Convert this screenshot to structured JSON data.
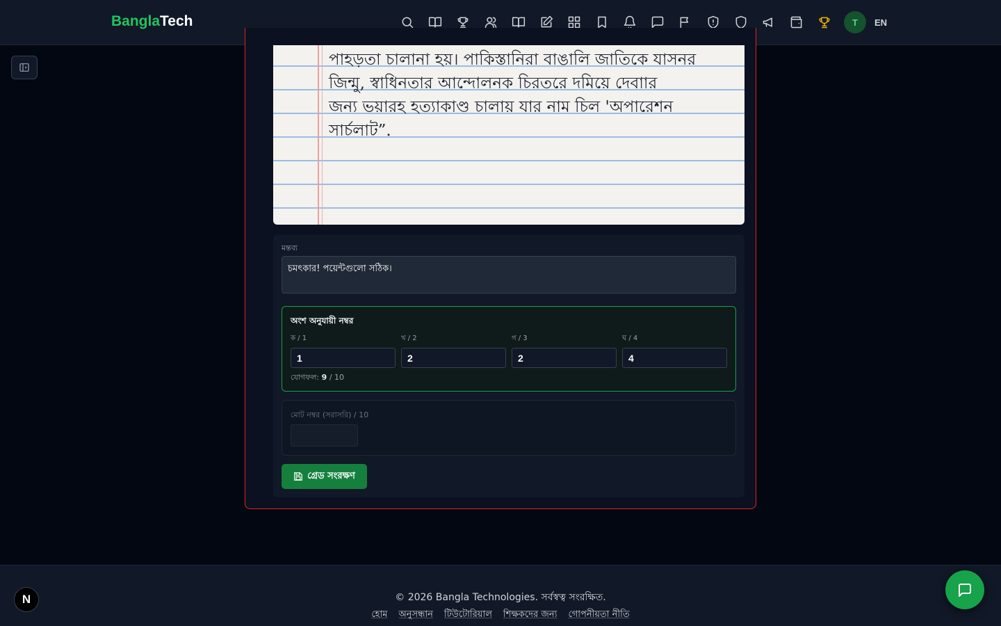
{
  "header": {
    "logo_part1": "Bangla",
    "logo_part2": "Tech",
    "nav_icons": [
      "search-icon",
      "book-icon",
      "trophy-icon",
      "users-icon",
      "book-open-icon",
      "edit-icon",
      "grid-icon",
      "bookmark-icon",
      "bell-icon",
      "message-icon",
      "flag-icon",
      "shield-alert-icon",
      "shield-icon",
      "megaphone-icon",
      "wallet-icon",
      "trophy-active-icon"
    ],
    "avatar_initial": "T",
    "language": "EN"
  },
  "submission": {
    "handwriting_lines": [
      "পাহড়তা চালানা হয়। পাকিস্তানিরা বাঙালি জাতিকে যাসনর",
      "জিন্মু, স্বাধিনতার আন্দোলনক  চিরতরে দমিয়ে দেবাার",
      "জন্য ভয়ারহ হত্যাকাণ্ড চালায় যার নাম চিল 'অপারেশন",
      "সার্চলাট”."
    ]
  },
  "grading": {
    "comment_label": "মন্তব্য",
    "comment_value": "চমৎকার! পয়েন্টগুলো সঠিক।",
    "parts_title": "অংশ অনুযায়ী নম্বর",
    "parts": [
      {
        "label": "ক / 1",
        "value": "1"
      },
      {
        "label": "খ / 2",
        "value": "2"
      },
      {
        "label": "গ / 3",
        "value": "2"
      },
      {
        "label": "ঘ / 4",
        "value": "4"
      }
    ],
    "sum_label": "যোগফল:",
    "sum_value": "9",
    "sum_max": "/ 10",
    "total_label": "মোট নম্বর (সরাসরি) / 10",
    "total_value": "",
    "save_label": "গ্রেড সংরক্ষণ"
  },
  "footer": {
    "copyright": "© 2026 Bangla Technologies. সর্বস্বত্ব সংরক্ষিত.",
    "links": [
      "হোম",
      "অনুসন্ধান",
      "টিউটোরিয়াল",
      "শিক্ষকদের জন্য",
      "গোপনীয়তা নীতি"
    ],
    "badge": "N"
  },
  "colors": {
    "accent": "#16a34a",
    "card_border": "#dc2626",
    "gold": "#eab308"
  }
}
